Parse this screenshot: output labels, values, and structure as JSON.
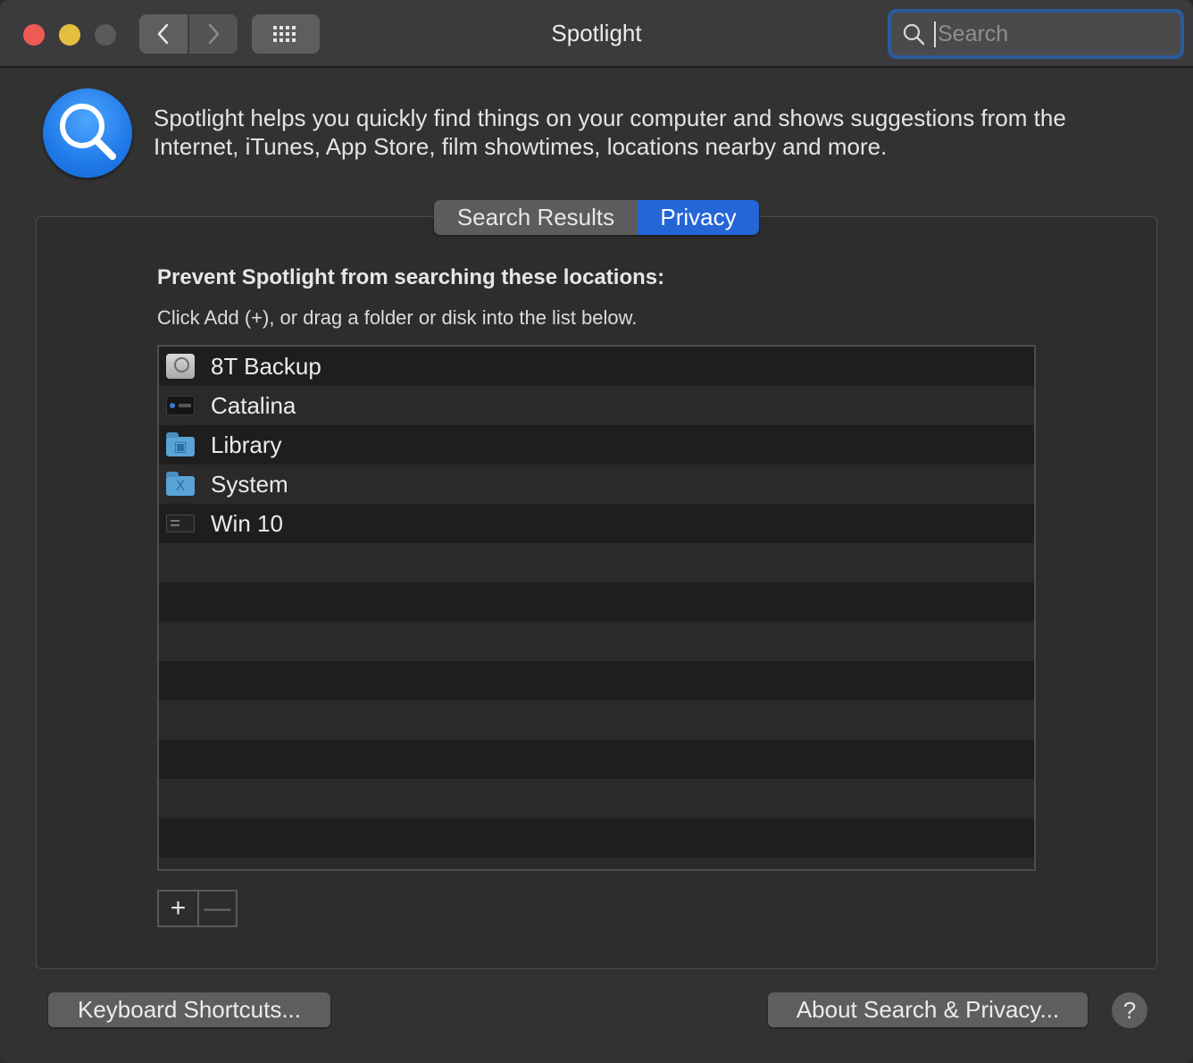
{
  "window": {
    "title": "Spotlight"
  },
  "toolbar": {
    "back_icon": "chevron-left-icon",
    "forward_icon": "chevron-right-icon",
    "grid_icon": "grid-icon"
  },
  "search": {
    "placeholder": "Search",
    "value": ""
  },
  "header": {
    "description": "Spotlight helps you quickly find things on your computer and shows suggestions from the Internet, iTunes, App Store, film showtimes, locations nearby and more."
  },
  "tabs": [
    {
      "label": "Search Results",
      "selected": false
    },
    {
      "label": "Privacy",
      "selected": true
    }
  ],
  "privacy": {
    "heading": "Prevent Spotlight from searching these locations:",
    "instructions": "Click Add (+), or drag a folder or disk into the list below.",
    "locations": [
      {
        "label": "8T Backup",
        "icon": "backup-disk-icon"
      },
      {
        "label": "Catalina",
        "icon": "disk-icon"
      },
      {
        "label": "Library",
        "icon": "library-folder-icon"
      },
      {
        "label": "System",
        "icon": "system-folder-icon"
      },
      {
        "label": "Win 10",
        "icon": "windows-disk-icon"
      }
    ],
    "add_label": "+",
    "remove_label": "—"
  },
  "footer": {
    "keyboard_shortcuts": "Keyboard Shortcuts...",
    "about": "About Search & Privacy...",
    "help": "?"
  },
  "colors": {
    "accent": "#2466d6",
    "close": "#ed5b54",
    "minimize": "#e3be3f"
  }
}
